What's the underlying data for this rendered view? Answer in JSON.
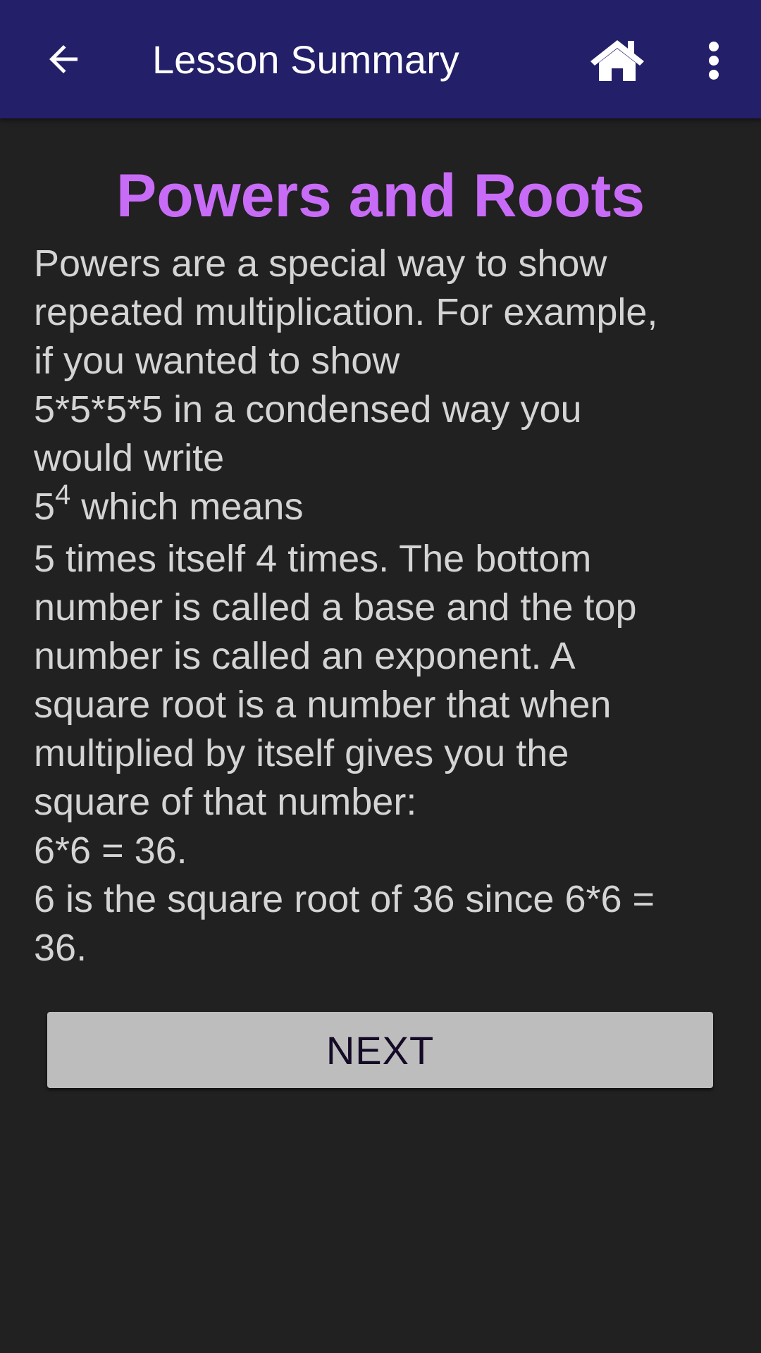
{
  "app_bar": {
    "title": "Lesson Summary",
    "back_icon": "arrow-left-icon",
    "home_icon": "home-icon",
    "more_icon": "more-vert-icon",
    "background": "#231f69"
  },
  "lesson": {
    "title": "Powers and Roots",
    "title_color": "#c86cf7",
    "body_lines": [
      "Powers are a special way to show",
      "repeated multiplication. For example,",
      "if you wanted to show",
      "5*5*5*5 in a condensed way you",
      "would write"
    ],
    "power_base": "5",
    "power_exponent": "4",
    "power_suffix": " which means",
    "body_lines_after": [
      "5 times itself 4 times. The bottom",
      "number is called a base and the top",
      "number is called an exponent. A",
      "square root is a number that when",
      "multiplied by itself gives you the",
      "square of that number:",
      "6*6 = 36.",
      "6 is the square root of 36 since 6*6 =",
      "36."
    ]
  },
  "next_button": {
    "label": "NEXT"
  }
}
